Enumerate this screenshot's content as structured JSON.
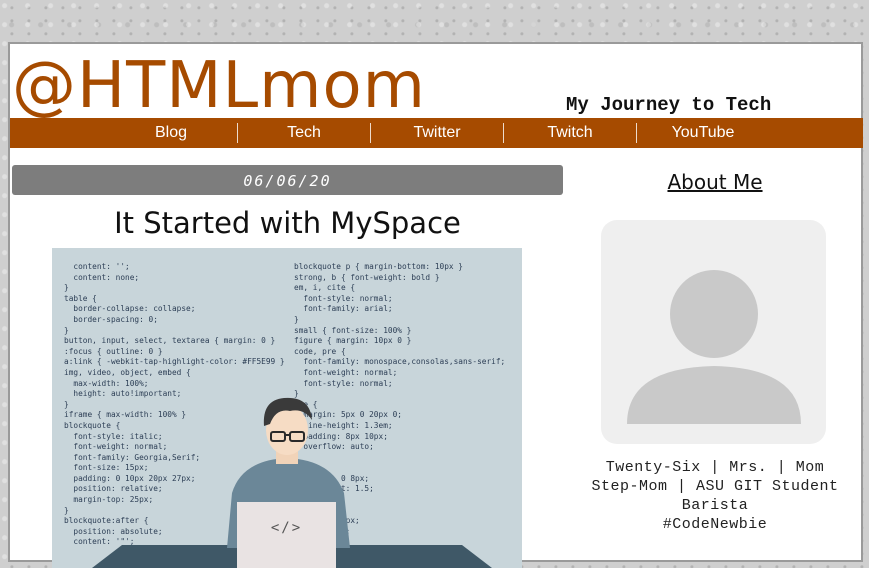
{
  "site": {
    "logo": "@HTMLmom",
    "tagline": "My Journey to Tech"
  },
  "nav": {
    "items": [
      {
        "label": "Blog"
      },
      {
        "label": "Tech"
      },
      {
        "label": "Twitter"
      },
      {
        "label": "Twitch"
      },
      {
        "label": "YouTube"
      }
    ]
  },
  "post": {
    "date": "06/06/20",
    "title": "It Started with MySpace",
    "code_left": "  content: '';\n  content: none;\n}\ntable {\n  border-collapse: collapse;\n  border-spacing: 0;\n}\nbutton, input, select, textarea { margin: 0 }\n:focus { outline: 0 }\na:link { -webkit-tap-highlight-color: #FF5E99 }\nimg, video, object, embed {\n  max-width: 100%;\n  height: auto!important;\n}\niframe { max-width: 100% }\nblockquote {\n  font-style: italic;\n  font-weight: normal;\n  font-family: Georgia,Serif;\n  font-size: 15px;\n  padding: 0 10px 20px 27px;\n  position: relative;\n  margin-top: 25px;\n}\nblockquote:after {\n  position: absolute;\n  content: '\"';",
    "code_right": "blockquote p { margin-bottom: 10px }\nstrong, b { font-weight: bold }\nem, i, cite {\n  font-style: normal;\n  font-family: arial;\n}\nsmall { font-size: 100% }\nfigure { margin: 10px 0 }\ncode, pre {\n  font-family: monospace,consolas,sans-serif;\n  font-weight: normal;\n  font-style: normal;\n}\npre {\n  margin: 5px 0 20px 0;\n  line-height: 1.3em;\n  padding: 8px 10px;\n  overflow: auto;\n}\n\n      ng: 0 8px;\n      eight: 1.5;\n\n\n    : 1px 6px;\n    : 0 2px;\n    lack;",
    "laptop_text": "</>"
  },
  "sidebar": {
    "about_title": "About Me",
    "bio": "Twenty-Six | Mrs. | Mom\nStep-Mom | ASU GIT Student\nBarista\n#CodeNewbie"
  },
  "colors": {
    "brand": "#a64b00",
    "datebar": "#7d7d7d",
    "hero_bg": "#c8d5da"
  }
}
